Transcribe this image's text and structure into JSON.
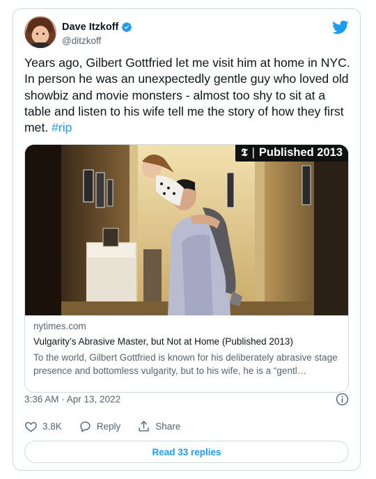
{
  "tweet": {
    "author": {
      "display_name": "Dave Itzkoff",
      "handle": "@ditzkoff",
      "verified": true
    },
    "text_parts": [
      "Years ago, Gilbert Gottfried let me visit him at home in NYC. In person he was an unexpectedly gentle guy who loved old showbiz and movie monsters - almost too shy to sit at a table and listen to his wife tell me the story of how they first met. "
    ],
    "hashtag": "#rip",
    "link_card": {
      "badge": "Published 2013",
      "badge_logo": "𝕿",
      "domain": "nytimes.com",
      "title": "Vulgarity’s Abrasive Master, but Not at Home (Published 2013)",
      "description": "To the world, Gilbert Gottfried is known for his deliberately abrasive stage presence and bottomless vulgarity, but to his wife, he is a “gentl…"
    },
    "timestamp": "3:36 AM · Apr 13, 2022",
    "actions": {
      "like_count": "3.8K",
      "reply_label": "Reply",
      "share_label": "Share"
    },
    "read_replies_label": "Read 33 replies"
  },
  "colors": {
    "accent": "#1d9bf0",
    "text": "#0f1419",
    "secondary": "#536471",
    "border": "#cfd9de"
  },
  "icons": [
    "verified-badge-icon",
    "twitter-bird-icon",
    "info-icon",
    "heart-icon",
    "reply-bubble-icon",
    "share-icon"
  ]
}
